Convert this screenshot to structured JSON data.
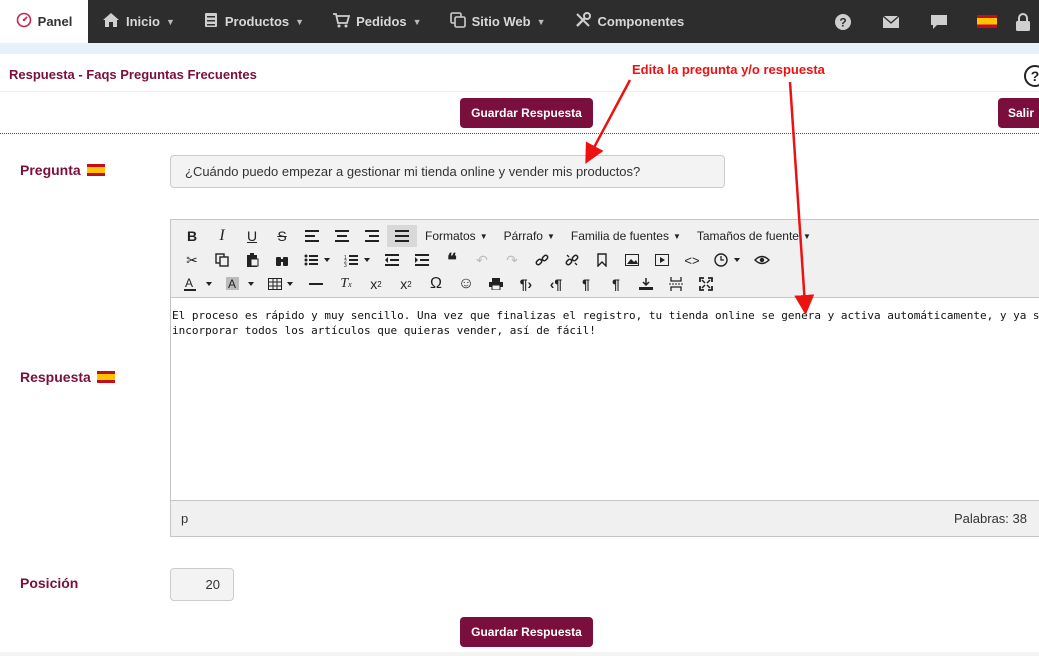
{
  "nav": {
    "panel": "Panel",
    "items": [
      {
        "label": "Inicio",
        "icon": "home-icon",
        "caret": true
      },
      {
        "label": "Productos",
        "icon": "box-icon",
        "caret": true
      },
      {
        "label": "Pedidos",
        "icon": "cart-icon",
        "caret": true
      },
      {
        "label": "Sitio Web",
        "icon": "copy-icon",
        "caret": true
      },
      {
        "label": "Componentes",
        "icon": "tools-icon",
        "caret": false
      }
    ],
    "right_icons": [
      "help-icon",
      "mail-icon",
      "chat-icon",
      "flag-es-icon",
      "lock-icon"
    ]
  },
  "page": {
    "title": "Respuesta - Faqs Preguntas Frecuentes",
    "save_label": "Guardar Respuesta",
    "exit_label": "Salir"
  },
  "form": {
    "question_label": "Pregunta",
    "question_value": "¿Cuándo puedo empezar a gestionar mi tienda online y vender mis productos?",
    "answer_label": "Respuesta",
    "position_label": "Posición",
    "position_value": "20"
  },
  "editor": {
    "dropdowns": [
      "Formatos",
      "Párrafo",
      "Familia de fuentes",
      "Tamaños de fuente"
    ],
    "content_line1": "El proceso es rápido y muy sencillo. Una vez que finalizas el registro, tu tienda online se genera y activa automáticamente, y ya solo resta que empieces a",
    "content_line2": "incorporar todos los artículos que quieras vender, así de fácil!",
    "path": "p",
    "word_count": "Palabras: 38"
  },
  "annotation": "Edita la pregunta y/o respuesta",
  "colors": {
    "brand": "#7a0f3d",
    "nav_bg": "#2d2d2d",
    "annotation": "#ee1111"
  }
}
